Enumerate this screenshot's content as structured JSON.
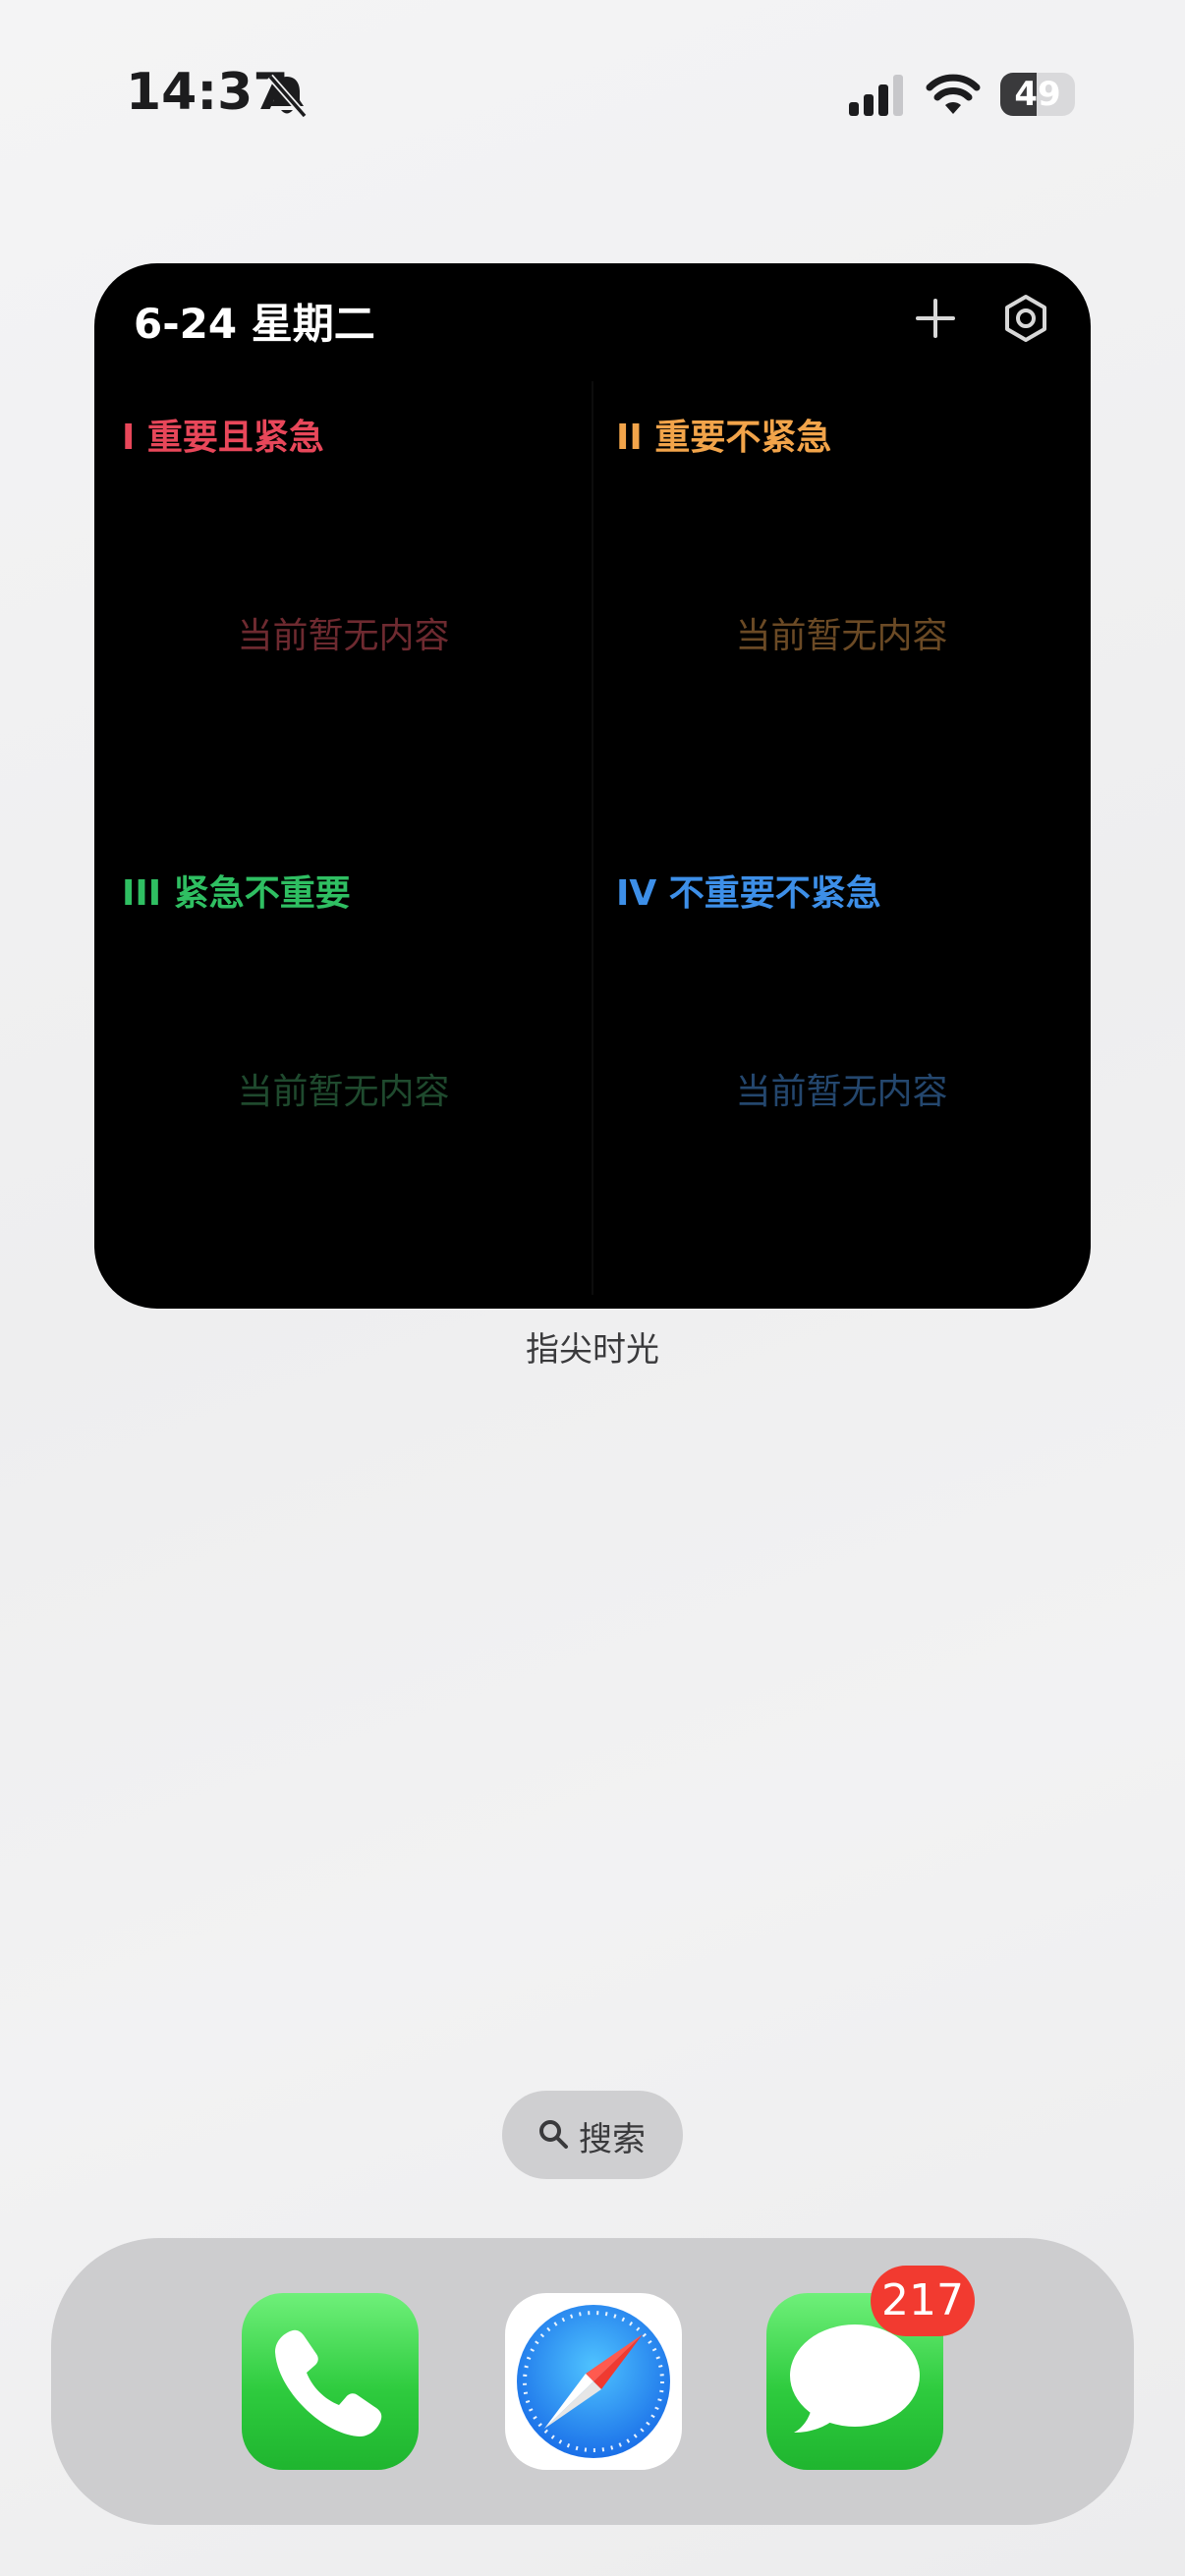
{
  "status_bar": {
    "time": "14:37",
    "battery_level": "49",
    "battery_fraction": 0.49,
    "icons": [
      "bell-slash-icon",
      "cellular-signal-icon",
      "wifi-icon",
      "battery-icon"
    ]
  },
  "widget": {
    "date": "6-24 星期二",
    "add_icon": "plus-icon",
    "settings_icon": "gear-icon",
    "quadrants": [
      {
        "title": "I 重要且紧急",
        "empty_text": "当前暂无内容",
        "color": "#e8475a",
        "muted_color": "#6e2a30"
      },
      {
        "title": "II 重要不紧急",
        "empty_text": "当前暂无内容",
        "color": "#f2a44a",
        "muted_color": "#6b4a25"
      },
      {
        "title": "III 紧急不重要",
        "empty_text": "当前暂无内容",
        "color": "#2fbf62",
        "muted_color": "#1f4a2e"
      },
      {
        "title": "IV 不重要不紧急",
        "empty_text": "当前暂无内容",
        "color": "#3d8fe8",
        "muted_color": "#24476e"
      }
    ],
    "label": "指尖时光"
  },
  "search": {
    "icon": "search-icon",
    "label": "搜索"
  },
  "dock": {
    "apps": [
      {
        "name": "Phone",
        "icon": "phone-icon"
      },
      {
        "name": "Safari",
        "icon": "compass-icon"
      },
      {
        "name": "Messages",
        "icon": "message-bubble-icon",
        "badge": "217"
      }
    ]
  }
}
